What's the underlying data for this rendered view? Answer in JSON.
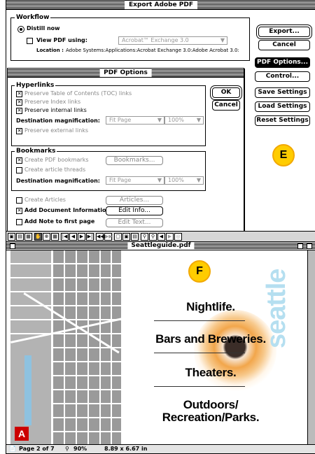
{
  "export_window": {
    "title": "Export Adobe PDF",
    "workflow_label": "Workflow",
    "distill_now": "Distill now",
    "view_pdf_using": "View PDF using:",
    "viewer_app": "Acrobat™ Exchange 3.0",
    "location_label": "Location :",
    "location_value": "Adobe Systems:Applications:Acrobat Exchange 3.0:Adobe Acrobat 3.0:",
    "buttons": {
      "export": "Export...",
      "cancel": "Cancel",
      "pdf_options": "PDF Options...",
      "control": "Control...",
      "save_settings": "Save Settings",
      "load_settings": "Load Settings",
      "reset_settings": "Reset Settings"
    }
  },
  "pdf_options": {
    "title": "PDF Options",
    "hyperlinks_label": "Hyperlinks",
    "preserve_toc": "Preserve Table of Contents (TOC) links",
    "preserve_index": "Preserve Index links",
    "preserve_internal": "Preserve internal links",
    "dest_mag_label": "Destination magnification:",
    "fit_page": "Fit Page",
    "zoom_pct": "100%",
    "preserve_external": "Preserve external links",
    "ok": "OK",
    "cancel": "Cancel",
    "bookmarks_label": "Bookmarks",
    "create_bookmarks": "Create PDF bookmarks",
    "bookmarks_button": "Bookmarks...",
    "create_article": "Create article threads",
    "create_articles": "Create Articles",
    "articles_button": "Articles...",
    "add_doc_info": "Add Document Information",
    "edit_info": "Edit Info...",
    "add_note": "Add Note to first page",
    "edit_text": "Edit Text..."
  },
  "callouts": {
    "e": "E",
    "f": "F"
  },
  "viewer": {
    "title": "Seattleguide.pdf",
    "status_page": "Page 2 of 7",
    "status_zoom": "90%",
    "status_size": "8.89 x 6.67 in",
    "seattle_text": "seattle",
    "lines": [
      "Nightlife.",
      "Bars and Breweries.",
      "Theaters.",
      "Outdoors/",
      "Recreation/Parks."
    ],
    "colors": {
      "circle_fill": "#ffcc00",
      "swirl_orange": "#f29a2e",
      "seattle_blue": "#a8d8ea",
      "adobe_red": "#cc0000"
    }
  }
}
